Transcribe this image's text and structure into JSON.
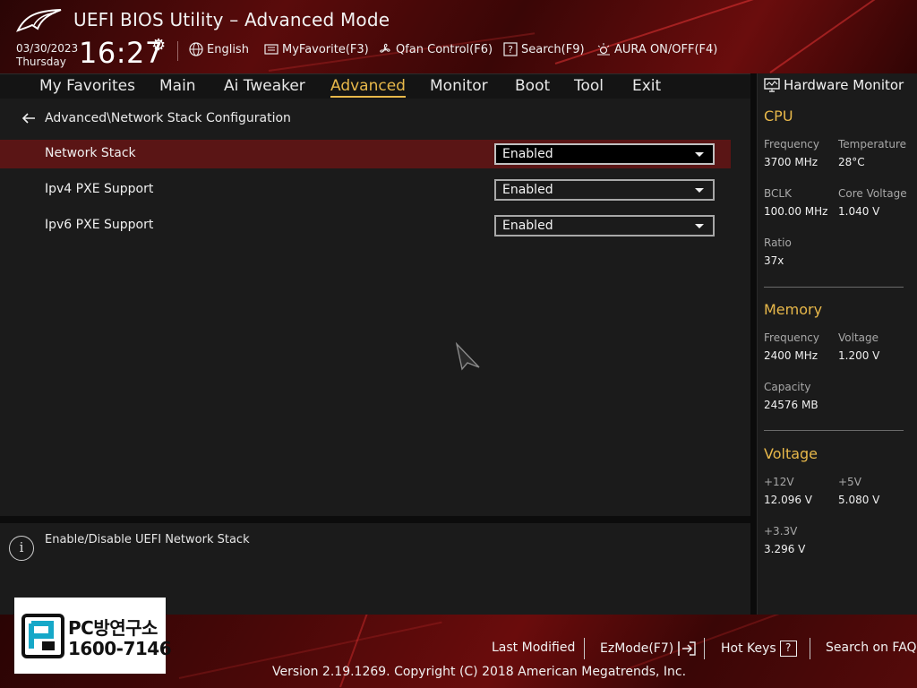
{
  "header": {
    "title": "UEFI BIOS Utility – Advanced Mode",
    "date": "03/30/2023",
    "day": "Thursday",
    "time": "16:27",
    "tools": [
      {
        "label": "English",
        "icon": "globe-icon"
      },
      {
        "label": "MyFavorite(F3)",
        "icon": "favorite-icon"
      },
      {
        "label": "Qfan Control(F6)",
        "icon": "fan-icon"
      },
      {
        "label": "Search(F9)",
        "icon": "search-help-icon"
      },
      {
        "label": "AURA ON/OFF(F4)",
        "icon": "aura-icon"
      }
    ]
  },
  "nav": {
    "items": [
      "My Favorites",
      "Main",
      "Ai Tweaker",
      "Advanced",
      "Monitor",
      "Boot",
      "Tool",
      "Exit"
    ],
    "active": "Advanced"
  },
  "breadcrumb": "Advanced\\Network Stack Configuration",
  "settings": [
    {
      "label": "Network Stack",
      "value": "Enabled",
      "selected": true
    },
    {
      "label": "Ipv4 PXE Support",
      "value": "Enabled",
      "selected": false
    },
    {
      "label": "Ipv6 PXE Support",
      "value": "Enabled",
      "selected": false
    }
  ],
  "help_text": "Enable/Disable UEFI Network Stack",
  "hardware_monitor": {
    "title": "Hardware Monitor",
    "cpu": {
      "heading": "CPU",
      "frequency_label": "Frequency",
      "frequency": "3700 MHz",
      "temperature_label": "Temperature",
      "temperature": "28°C",
      "bclk_label": "BCLK",
      "bclk": "100.00 MHz",
      "core_voltage_label": "Core Voltage",
      "core_voltage": "1.040 V",
      "ratio_label": "Ratio",
      "ratio": "37x"
    },
    "memory": {
      "heading": "Memory",
      "frequency_label": "Frequency",
      "frequency": "2400 MHz",
      "voltage_label": "Voltage",
      "voltage": "1.200 V",
      "capacity_label": "Capacity",
      "capacity": "24576 MB"
    },
    "voltage": {
      "heading": "Voltage",
      "v12_label": "+12V",
      "v12": "12.096 V",
      "v5_label": "+5V",
      "v5": "5.080 V",
      "v33_label": "+3.3V",
      "v33": "3.296 V"
    }
  },
  "footer": {
    "last_modified": "Last Modified",
    "ezmode": "EzMode(F7)",
    "hot_keys": "Hot Keys",
    "hot_keys_key": "?",
    "search_faq": "Search on FAQ",
    "copyright": "Version 2.19.1269. Copyright (C) 2018 American Megatrends, Inc."
  },
  "watermark": {
    "line1": "PC방연구소",
    "line2": "1600-7146"
  },
  "colors": {
    "accent": "#e8b84a",
    "header_red": "#5a0b0b",
    "selected_row": "#5a1515",
    "panel": "#1b1b1b"
  }
}
